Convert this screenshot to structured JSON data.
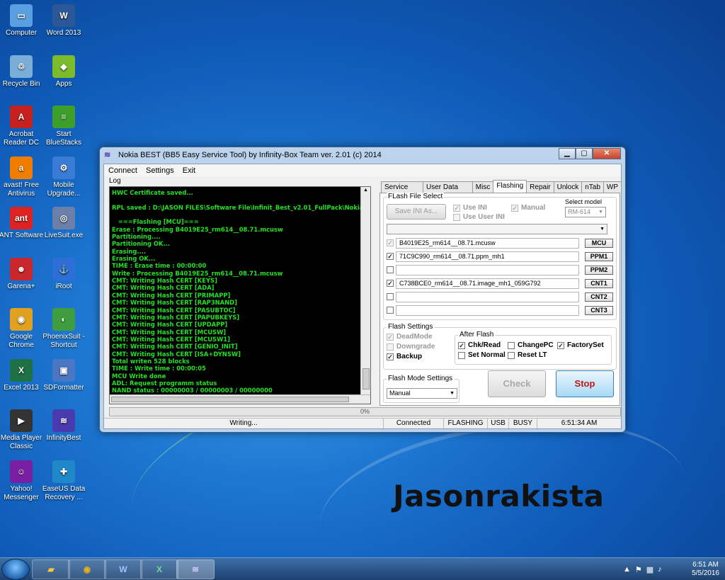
{
  "desktop": {
    "icons": [
      {
        "label": "Computer",
        "glyph": "▭",
        "color": "#5aa0e0"
      },
      {
        "label": "Word 2013",
        "glyph": "W",
        "color": "#2b5797"
      },
      {
        "label": "Recycle Bin",
        "glyph": "♲",
        "color": "#7aaed8"
      },
      {
        "label": "Apps",
        "glyph": "◆",
        "color": "#7cbc2c"
      },
      {
        "label": "Acrobat Reader DC",
        "glyph": "A",
        "color": "#c5221f"
      },
      {
        "label": "Start BlueStacks",
        "glyph": "≡",
        "color": "#3c9f2a"
      },
      {
        "label": "avast! Free Antivirus",
        "glyph": "a",
        "color": "#f07c00"
      },
      {
        "label": "Mobile Upgrade...",
        "glyph": "⚙",
        "color": "#3a7bd5"
      },
      {
        "label": "ANT Software",
        "glyph": "ant",
        "color": "#d22"
      },
      {
        "label": "LiveSuit.exe",
        "glyph": "◎",
        "color": "#6b7fa8"
      },
      {
        "label": "Garena+",
        "glyph": "☻",
        "color": "#c8282d"
      },
      {
        "label": "iRoot",
        "glyph": "⚓",
        "color": "#2d6fd6"
      },
      {
        "label": "Google Chrome",
        "glyph": "◉",
        "color": "#e0a020"
      },
      {
        "label": "PhoenixSuit - Shortcut",
        "glyph": "◐",
        "color": "#3f9d3f"
      },
      {
        "label": "Excel 2013",
        "glyph": "X",
        "color": "#1e7145"
      },
      {
        "label": "SDFormatter",
        "glyph": "▣",
        "color": "#4a77c4"
      },
      {
        "label": "Media Player Classic",
        "glyph": "▶",
        "color": "#333"
      },
      {
        "label": "InfinityBest",
        "glyph": "≋",
        "color": "#4a3ab0"
      },
      {
        "label": "Yahoo! Messenger",
        "glyph": "☺",
        "color": "#7b1fa2"
      },
      {
        "label": "EaseUS Data Recovery ...",
        "glyph": "✚",
        "color": "#1e88c8"
      }
    ],
    "watermark": "Jasonrakista"
  },
  "window": {
    "title": "Nokia BEST (BB5 Easy Service Tool) by Infinity-Box Team ver. 2.01 (c) 2014",
    "menu": [
      "Connect",
      "Settings",
      "Exit"
    ],
    "log_label": "Log",
    "log_lines": [
      "HWC Certificate saved...",
      "",
      "RPL saved : D:\\JASON FILES\\Software File\\Infinit_Best_v2.01_FullPack\\Nokia F",
      "",
      "   ===Flashing [MCU]===",
      "Erase : Processing B4019E25_rm614__08.71.mcusw",
      "Partitioning....",
      "Partitioning OK...",
      "Erasing....",
      "Erasing OK...",
      "TIME : Erase time : 00:00:00",
      "Write : Processing B4019E25_rm614__08.71.mcusw",
      "CMT: Writing Hash CERT [KEYS]",
      "CMT: Writing Hash CERT [ADA]",
      "CMT: Writing Hash CERT [PRIMAPP]",
      "CMT: Writing Hash CERT [RAP3NAND]",
      "CMT: Writing Hash CERT [PASUBTOC]",
      "CMT: Writing Hash CERT [PAPUBKEYS]",
      "CMT: Writing Hash CERT [UPDAPP]",
      "CMT: Writing Hash CERT [MCUSW]",
      "CMT: Writing Hash CERT [MCUSW1]",
      "CMT: Writing Hash CERT [GENIO_INIT]",
      "CMT: Writing Hash CERT [ISA+DYNSW]",
      "Total writen 528 blocks",
      "TIME : Write time : 00:00:05",
      "MCU Write done",
      "ADL: Request programm status",
      "NAND status : 00000003 / 00000003 / 00000000"
    ],
    "progress_text": "0%",
    "status": [
      "Writing...",
      "Connected",
      "FLASHING",
      "USB",
      "BUSY",
      "6:51:34 AM"
    ],
    "tabs": [
      "Service Tool",
      "User Data Tool",
      "Misc",
      "Flashing",
      "Repair",
      "Unlock",
      "nTab",
      "WP"
    ],
    "active_tab": "Flashing",
    "flash_file_select": {
      "group_title": "FLash File Select",
      "save_ini": "Save INI As...",
      "use_ini": "Use INI",
      "use_user_ini": "Use User INI",
      "manual": "Manual",
      "select_model_label": "Select model",
      "select_model_value": "RM-614",
      "top_combo": "",
      "files": [
        {
          "checked": true,
          "disabled": true,
          "value": "B4019E25_rm614__08.71.mcusw",
          "slot": "MCU"
        },
        {
          "checked": true,
          "disabled": false,
          "value": "71C9C990_rm614__08.71.ppm_mh1",
          "slot": "PPM1"
        },
        {
          "checked": false,
          "disabled": false,
          "value": "",
          "slot": "PPM2"
        },
        {
          "checked": true,
          "disabled": false,
          "value": "C738BCE0_rm614__08.71.image_mh1_059G792",
          "slot": "CNT1"
        },
        {
          "checked": false,
          "disabled": false,
          "value": "",
          "slot": "CNT2"
        },
        {
          "checked": false,
          "disabled": false,
          "value": "",
          "slot": "CNT3"
        }
      ]
    },
    "flash_settings": {
      "title": "Flash Settings",
      "dead_mode": "DeadMode",
      "downgrade": "Downgrade",
      "backup": "Backup",
      "after_flash_title": "After Flash",
      "chk_read": "Chk/Read",
      "set_normal": "Set Normal",
      "change_pc": "ChangePC",
      "reset_lt": "Reset LT",
      "factory_set": "FactorySet"
    },
    "flash_mode": {
      "title": "Flash Mode Settings",
      "value": "Manual"
    },
    "check_button": "Check",
    "stop_button": "Stop"
  },
  "taskbar": {
    "time": "6:51 AM",
    "date": "5/5/2016"
  }
}
